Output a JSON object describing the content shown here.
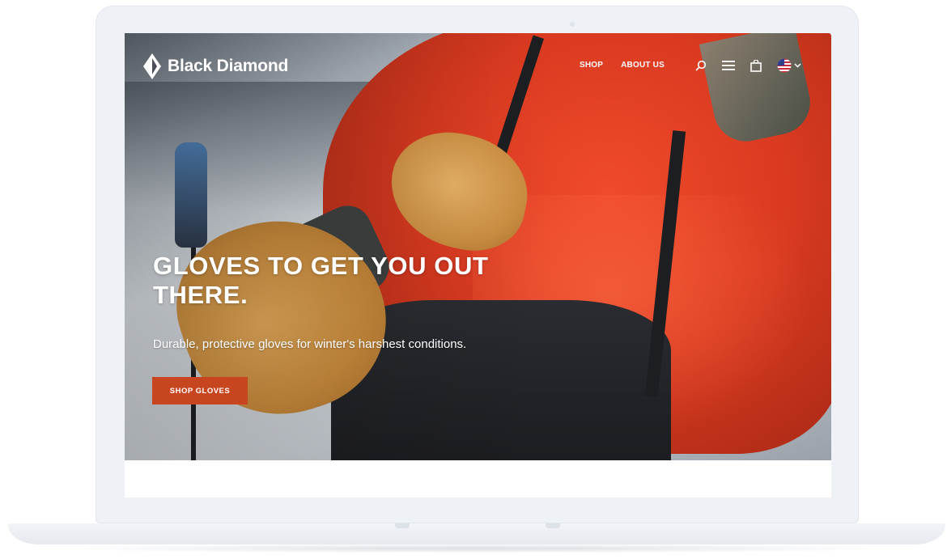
{
  "brand": {
    "name": "Black Diamond",
    "logo_icon": "diamond-logo-icon"
  },
  "nav": {
    "items": [
      {
        "label": "SHOP"
      },
      {
        "label": "ABOUT US"
      }
    ]
  },
  "header_icons": {
    "search": "search-icon",
    "menu": "menu-icon",
    "cart": "shopping-bag-icon",
    "locale": "us-flag-icon",
    "locale_dropdown": "chevron-down-icon"
  },
  "hero": {
    "headline": "GLOVES TO GET YOU OUT THERE.",
    "subheadline": "Durable, protective gloves for winter's harshest conditions.",
    "cta_label": "SHOP GLOVES"
  },
  "colors": {
    "cta": "#c8461f",
    "text": "#ffffff",
    "device": "#eef1f6"
  }
}
